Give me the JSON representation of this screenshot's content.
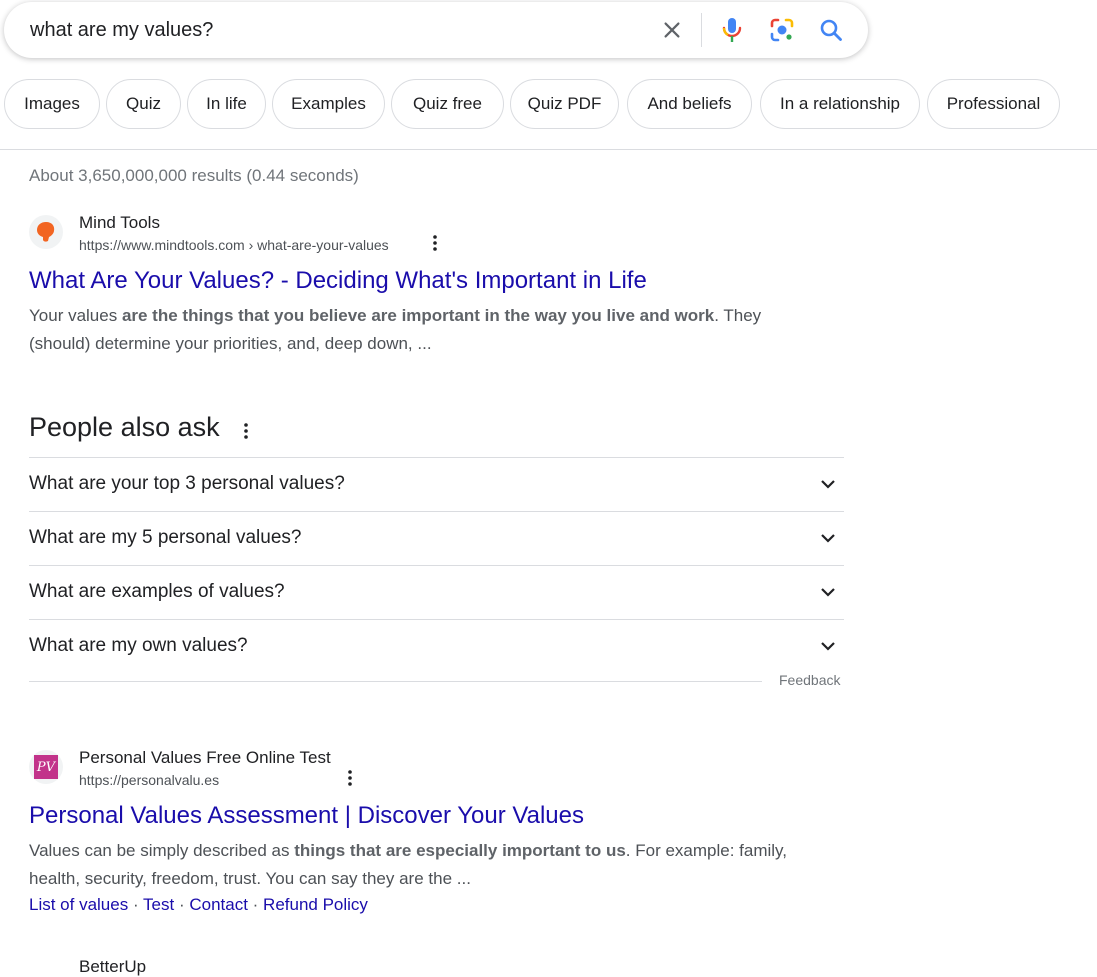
{
  "search": {
    "query": "what are my values?"
  },
  "chips": [
    {
      "label": "Images"
    },
    {
      "label": "Quiz"
    },
    {
      "label": "In life"
    },
    {
      "label": "Examples"
    },
    {
      "label": "Quiz free"
    },
    {
      "label": "Quiz PDF"
    },
    {
      "label": "And beliefs"
    },
    {
      "label": "In a relationship"
    },
    {
      "label": "Professional"
    }
  ],
  "stats": "About 3,650,000,000 results (0.44 seconds)",
  "results": [
    {
      "site_name": "Mind Tools",
      "url": "https://www.mindtools.com › what-are-your-values",
      "title": "What Are Your Values? - Deciding What's Important in Life",
      "snippet_pre": "Your values ",
      "snippet_bold": "are the things that you believe are important in the way you live and work",
      "snippet_post": ". They (should) determine your priorities, and, deep down, ..."
    },
    {
      "site_name": "Personal Values Free Online Test",
      "url": "https://personalvalu.es",
      "title": "Personal Values Assessment | Discover Your Values",
      "snippet_pre": "Values can be simply described as ",
      "snippet_bold": "things that are especially important to us",
      "snippet_post": ". For example: family, health, security, freedom, trust. You can say they are the ...",
      "favicon_text": "PV",
      "sitelinks": [
        "List of values",
        "Test",
        "Contact",
        "Refund Policy"
      ]
    }
  ],
  "people_also_ask": {
    "title": "People also ask",
    "questions": [
      "What are your top 3 personal values?",
      "What are my 5 personal values?",
      "What are examples of values?",
      "What are my own values?"
    ],
    "feedback": "Feedback"
  },
  "partial_next_result": "BetterUp",
  "colors": {
    "link": "#1a0dab",
    "text": "#202124",
    "muted": "#70757a",
    "mindtools_orange": "#f26522",
    "pv_pink": "#c2338a"
  }
}
